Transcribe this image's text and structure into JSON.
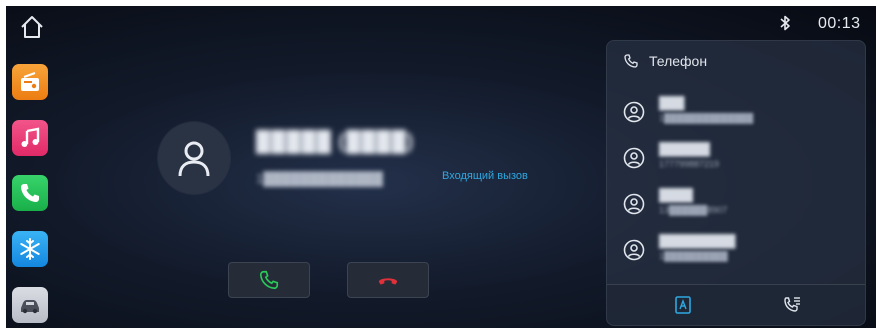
{
  "status": {
    "time": "00:13",
    "bluetooth_icon": "bluetooth-icon"
  },
  "dock": {
    "items": [
      {
        "name": "home",
        "icon": "home-icon"
      },
      {
        "name": "radio",
        "icon": "radio-icon",
        "color": "#f29029"
      },
      {
        "name": "music",
        "icon": "music-icon",
        "color": "#e83b77"
      },
      {
        "name": "phone",
        "icon": "phone-icon",
        "color": "#27c158"
      },
      {
        "name": "climate",
        "icon": "snowflake-icon",
        "color": "#259ceb"
      },
      {
        "name": "vehicle",
        "icon": "car-icon"
      }
    ]
  },
  "call": {
    "caller_name": "█████ (████)",
    "caller_number": "1█████████████",
    "status_text": "Входящий вызов",
    "accept_color": "#2bc85a",
    "decline_color": "#e0313a"
  },
  "phone_panel": {
    "title": "Телефон",
    "contacts": [
      {
        "name": "███",
        "number": "1██████████████"
      },
      {
        "name": "██████",
        "number": "177799887219"
      },
      {
        "name": "████",
        "number": "13██████8907"
      },
      {
        "name": "█████████",
        "number": "1██████████"
      }
    ]
  },
  "accent_color": "#2ea8e0"
}
